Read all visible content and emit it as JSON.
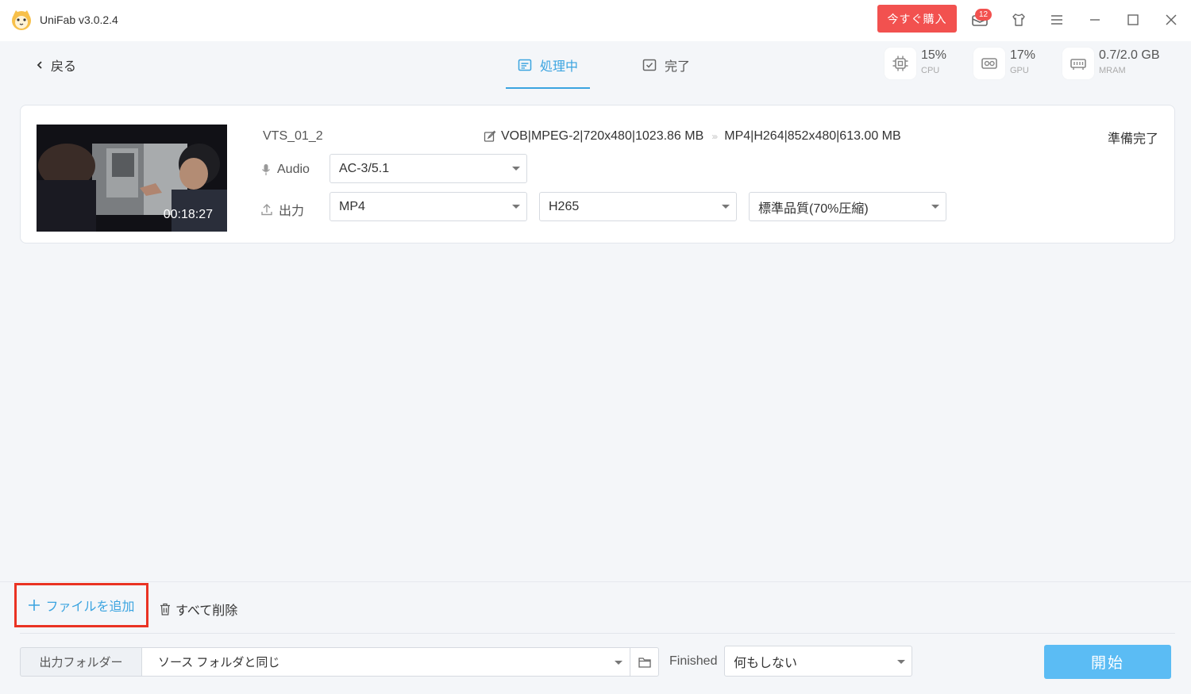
{
  "window": {
    "title": "UniFab v3.0.2.4",
    "buy_label": "今すぐ購入",
    "notification_count": "12"
  },
  "nav": {
    "back_label": "戻る",
    "tabs": [
      {
        "label": "処理中",
        "active": true
      },
      {
        "label": "完了",
        "active": false
      }
    ]
  },
  "stats": {
    "cpu": {
      "value": "15%",
      "label": "CPU"
    },
    "gpu": {
      "value": "17%",
      "label": "GPU"
    },
    "mram": {
      "value": "0.7/2.0 GB",
      "label": "MRAM"
    }
  },
  "file": {
    "name": "VTS_01_2",
    "duration": "00:18:27",
    "source_info": "VOB|MPEG-2|720x480|1023.86 MB",
    "target_info": "MP4|H264|852x480|613.00 MB",
    "status": "準備完了",
    "audio_label": "Audio",
    "audio_value": "AC-3/5.1",
    "output_label": "出力",
    "format_value": "MP4",
    "codec_value": "H265",
    "quality_value": "標準品質(70%圧縮)"
  },
  "bottom": {
    "add_file_label": "ファイルを追加",
    "delete_all_label": "すべて削除",
    "output_folder_label": "出力フォルダー",
    "output_folder_value": "ソース フォルダと同じ",
    "finished_label": "Finished",
    "finished_value": "何もしない",
    "start_label": "開始"
  },
  "colors": {
    "accent": "#3ba4e0",
    "buy": "#f2514f",
    "start": "#5bbcf4",
    "highlight": "#ea3323"
  }
}
